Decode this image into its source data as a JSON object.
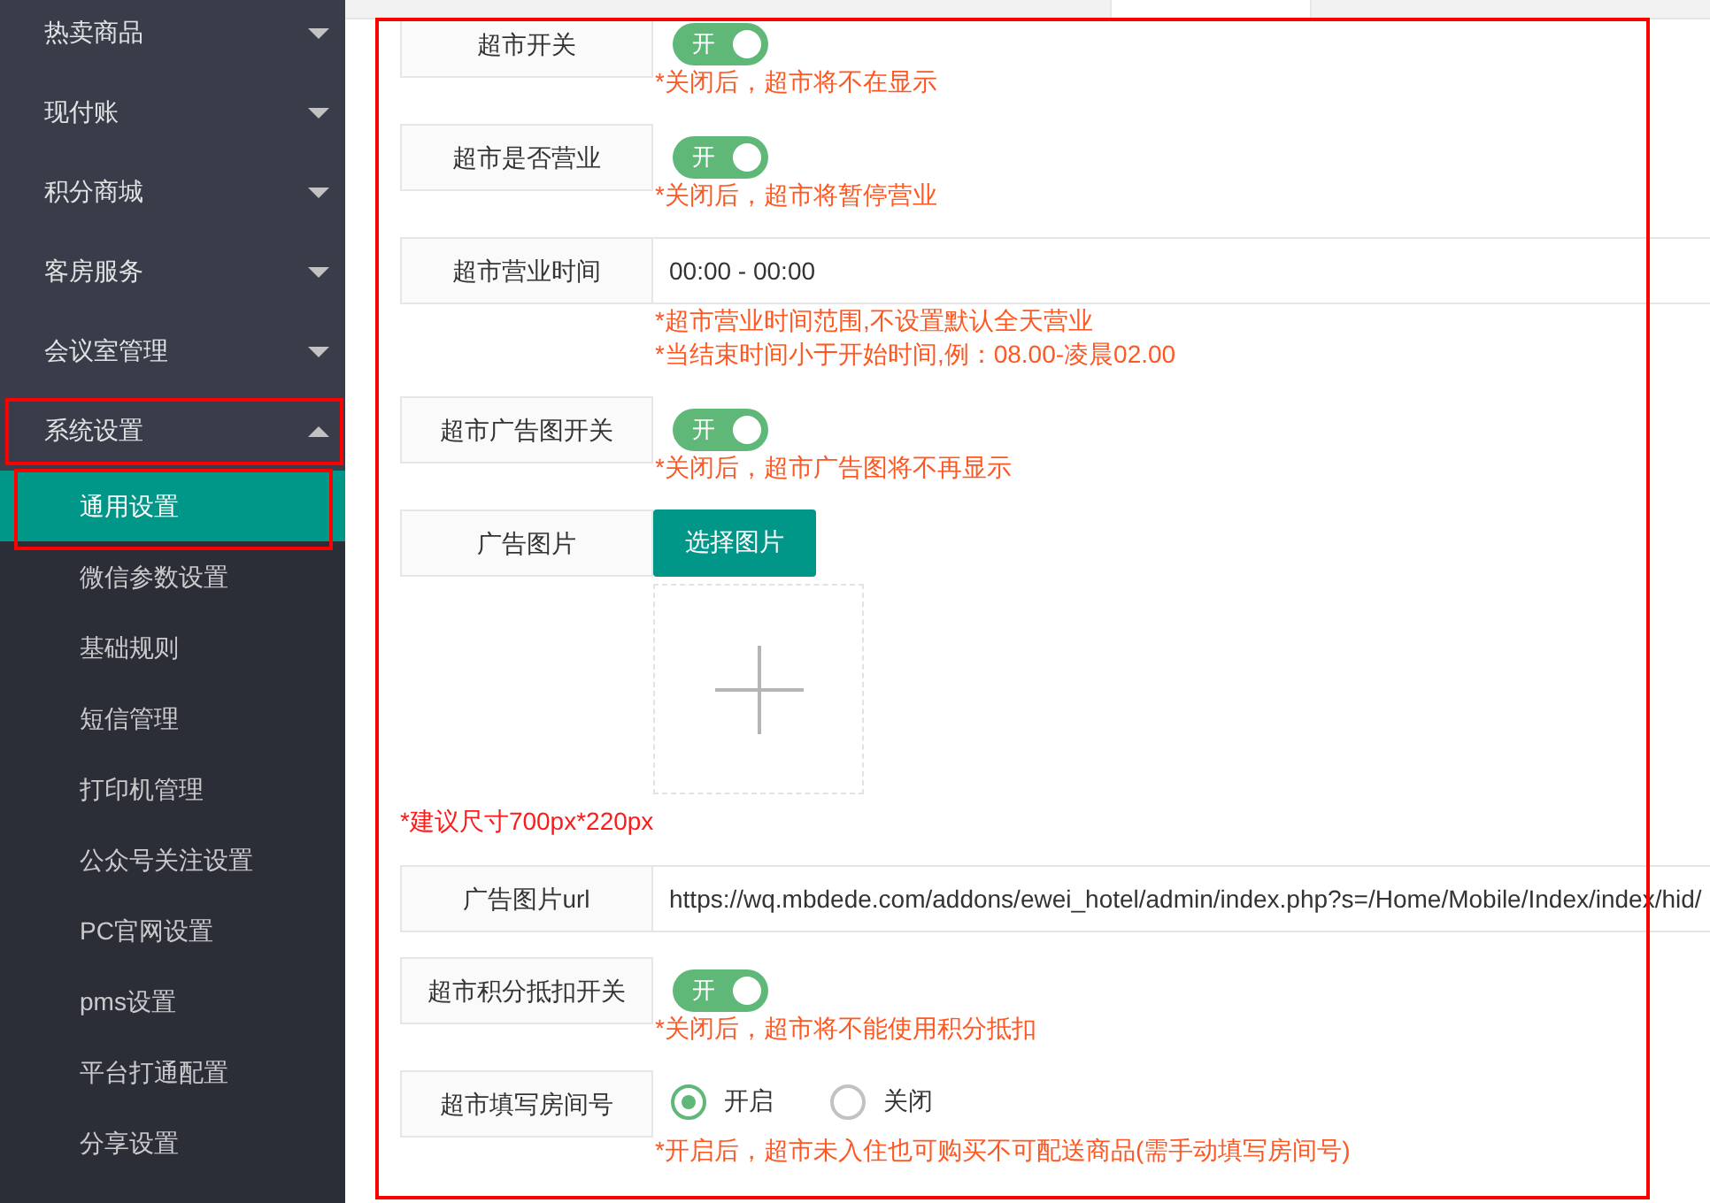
{
  "sidebar": {
    "items": [
      {
        "label": "热卖商品",
        "expanded": false
      },
      {
        "label": "现付账",
        "expanded": false
      },
      {
        "label": "积分商城",
        "expanded": false
      },
      {
        "label": "客房服务",
        "expanded": false
      },
      {
        "label": "会议室管理",
        "expanded": false
      },
      {
        "label": "系统设置",
        "expanded": true,
        "children": [
          {
            "label": "通用设置",
            "selected": true
          },
          {
            "label": "微信参数设置",
            "selected": false
          },
          {
            "label": "基础规则",
            "selected": false
          },
          {
            "label": "短信管理",
            "selected": false
          },
          {
            "label": "打印机管理",
            "selected": false
          },
          {
            "label": "公众号关注设置",
            "selected": false
          },
          {
            "label": "PC官网设置",
            "selected": false
          },
          {
            "label": "pms设置",
            "selected": false
          },
          {
            "label": "平台打通配置",
            "selected": false
          },
          {
            "label": "分享设置",
            "selected": false
          }
        ]
      }
    ]
  },
  "form": {
    "items": [
      {
        "kind": "toggle",
        "label": "超市开关",
        "on": true,
        "toggle_text": "开",
        "hints": [
          "*关闭后，超市将不在显示"
        ]
      },
      {
        "kind": "toggle",
        "label": "超市是否营业",
        "on": true,
        "toggle_text": "开",
        "hints": [
          "*关闭后，超市将暂停营业"
        ]
      },
      {
        "kind": "input",
        "label": "超市营业时间",
        "value": "00:00 - 00:00",
        "hints": [
          "*超市营业时间范围,不设置默认全天营业",
          "*当结束时间小于开始时间,例：08.00-凌晨02.00"
        ]
      },
      {
        "kind": "toggle",
        "label": "超市广告图开关",
        "on": true,
        "toggle_text": "开",
        "hints": [
          "*关闭后，超市广告图将不再显示"
        ]
      },
      {
        "kind": "upload",
        "label": "广告图片",
        "button": "选择图片"
      },
      {
        "kind": "note",
        "text": "*建议尺寸700px*220px"
      },
      {
        "kind": "input",
        "label": "广告图片url",
        "value": "https://wq.mbdede.com/addons/ewei_hotel/admin/index.php?s=/Home/Mobile/Index/index/hid/"
      },
      {
        "kind": "toggle",
        "label": "超市积分抵扣开关",
        "on": true,
        "toggle_text": "开",
        "hints": [
          "*关闭后，超市将不能使用积分抵扣"
        ]
      },
      {
        "kind": "radio",
        "label": "超市填写房间号",
        "options": [
          {
            "label": "开启",
            "selected": true
          },
          {
            "label": "关闭",
            "selected": false
          }
        ],
        "hints": [
          "*开启后，超市未入住也可购买不可配送商品(需手动填写房间号)"
        ]
      }
    ]
  }
}
